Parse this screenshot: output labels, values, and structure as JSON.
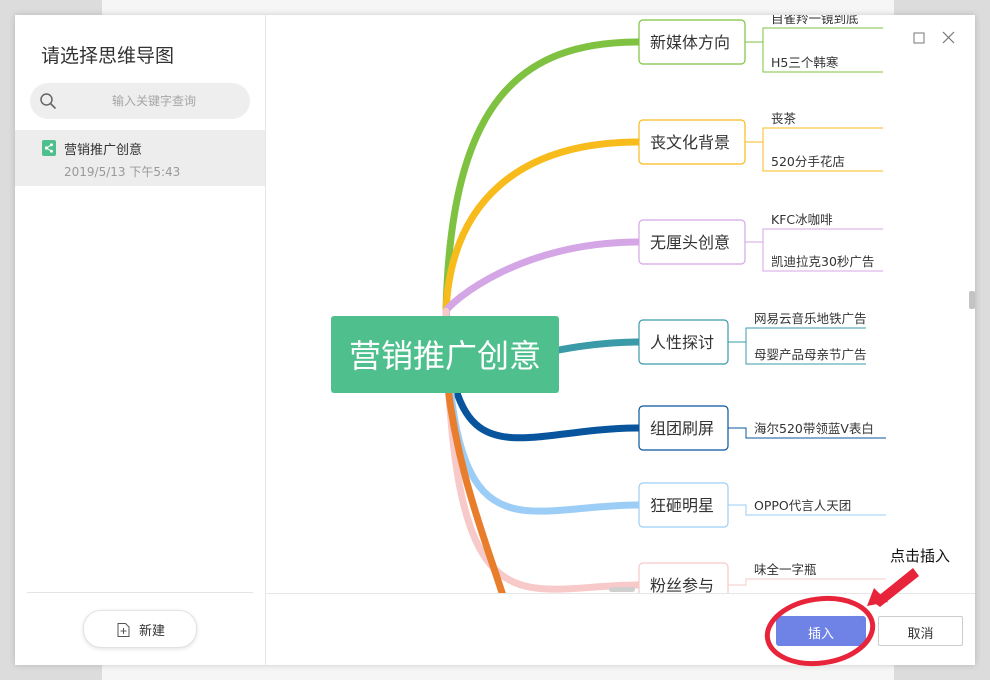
{
  "sidebar": {
    "title": "请选择思维导图",
    "search_placeholder": "输入关键字查询",
    "file": {
      "name": "营销推广创意",
      "date": "2019/5/13 下午5:43"
    },
    "new_label": "新建"
  },
  "mindmap": {
    "root": "营销推广创意",
    "root_color": "#4fc08d",
    "branches": [
      {
        "label": "新媒体方向",
        "color": "#7fc241",
        "leaves": [
          "自雀羚一镜到底",
          "H5三个韩寒"
        ]
      },
      {
        "label": "丧文化背景",
        "color": "#f8bb1c",
        "leaves": [
          "丧茶",
          "520分手花店"
        ]
      },
      {
        "label": "无厘头创意",
        "color": "#d4a6e6",
        "leaves": [
          "KFC冰咖啡",
          "凯迪拉克30秒广告"
        ]
      },
      {
        "label": "人性探讨",
        "color": "#3a9aa8",
        "leaves": [
          "网易云音乐地铁广告",
          "母婴产品母亲节广告"
        ]
      },
      {
        "label": "组团刷屏",
        "color": "#08559e",
        "leaves": [
          "海尔520带领蓝V表白"
        ]
      },
      {
        "label": "狂砸明星",
        "color": "#9ccdf6",
        "leaves": [
          "OPPO代言人天团"
        ]
      },
      {
        "label": "粉丝参与",
        "color": "#f7c9c9",
        "leaves": [
          "味全一字瓶"
        ]
      }
    ]
  },
  "footer": {
    "insert_label": "插入",
    "cancel_label": "取消"
  },
  "annotation": {
    "text": "点击插入",
    "color": "#e8243a"
  }
}
